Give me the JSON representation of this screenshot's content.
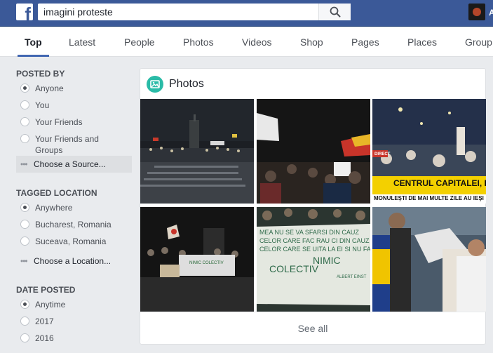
{
  "header": {
    "search_query": "imagini proteste",
    "user_initial": "A",
    "colors": {
      "bar": "#3b5998",
      "accent": "#4267b2"
    }
  },
  "tabs": [
    {
      "label": "Top",
      "active": true
    },
    {
      "label": "Latest"
    },
    {
      "label": "People"
    },
    {
      "label": "Photos"
    },
    {
      "label": "Videos"
    },
    {
      "label": "Shop"
    },
    {
      "label": "Pages"
    },
    {
      "label": "Places"
    },
    {
      "label": "Group"
    }
  ],
  "filters": {
    "posted_by": {
      "heading": "POSTED BY",
      "options": [
        "Anyone",
        "You",
        "Your Friends",
        "Your Friends and Groups"
      ],
      "choose": "Choose a Source..."
    },
    "tagged_location": {
      "heading": "TAGGED LOCATION",
      "options": [
        "Anywhere",
        "Bucharest, Romania",
        "Suceava, Romania"
      ],
      "choose": "Choose a Location..."
    },
    "date_posted": {
      "heading": "DATE POSTED",
      "options": [
        "Anytime",
        "2017",
        "2016"
      ]
    }
  },
  "photos": {
    "title": "Photos",
    "see_all": "See all",
    "captions": {
      "news_banner": "CENTRUL CAPITALEI, B",
      "news_ticker": "MONULEŞTI DE MAI MULTE ZILE AU IEŞI",
      "news_channel": "DIRECT",
      "banner_line1": "MEA NU SE VA SFARSI DIN CAUZ",
      "banner_line2": "CELOR CARE FAC RAU CI DIN CAUZ",
      "banner_line3": "CELOR CARE SE UITA LA EI SI NU FA",
      "banner_line4": "NIMIC",
      "banner_line5": "COLECTIV",
      "banner_sign": "ALBERT EINST",
      "small_banner": "NIMIC COLECTIV"
    }
  }
}
